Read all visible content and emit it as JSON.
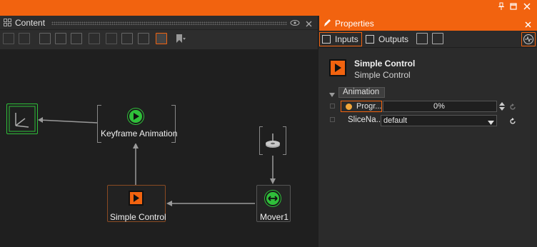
{
  "colors": {
    "accent": "#f2630f",
    "play_green": "#2fbf3a",
    "orange_play": "#f2630f"
  },
  "content_panel": {
    "title": "Content"
  },
  "nodes": {
    "keyframe_animation": "Keyframe Animation",
    "simple_control": "Simple Control",
    "mover": "Mover1"
  },
  "properties": {
    "title": "Properties",
    "tabs": {
      "inputs": "Inputs",
      "outputs": "Outputs"
    },
    "object_title": "Simple Control",
    "object_subtitle": "Simple Control",
    "section": "Animation",
    "rows": {
      "progress_label": "Progr...",
      "progress_value": "0%",
      "progress_fraction": 0.0,
      "slice_label": "SliceNa...",
      "slice_value": "default"
    }
  }
}
